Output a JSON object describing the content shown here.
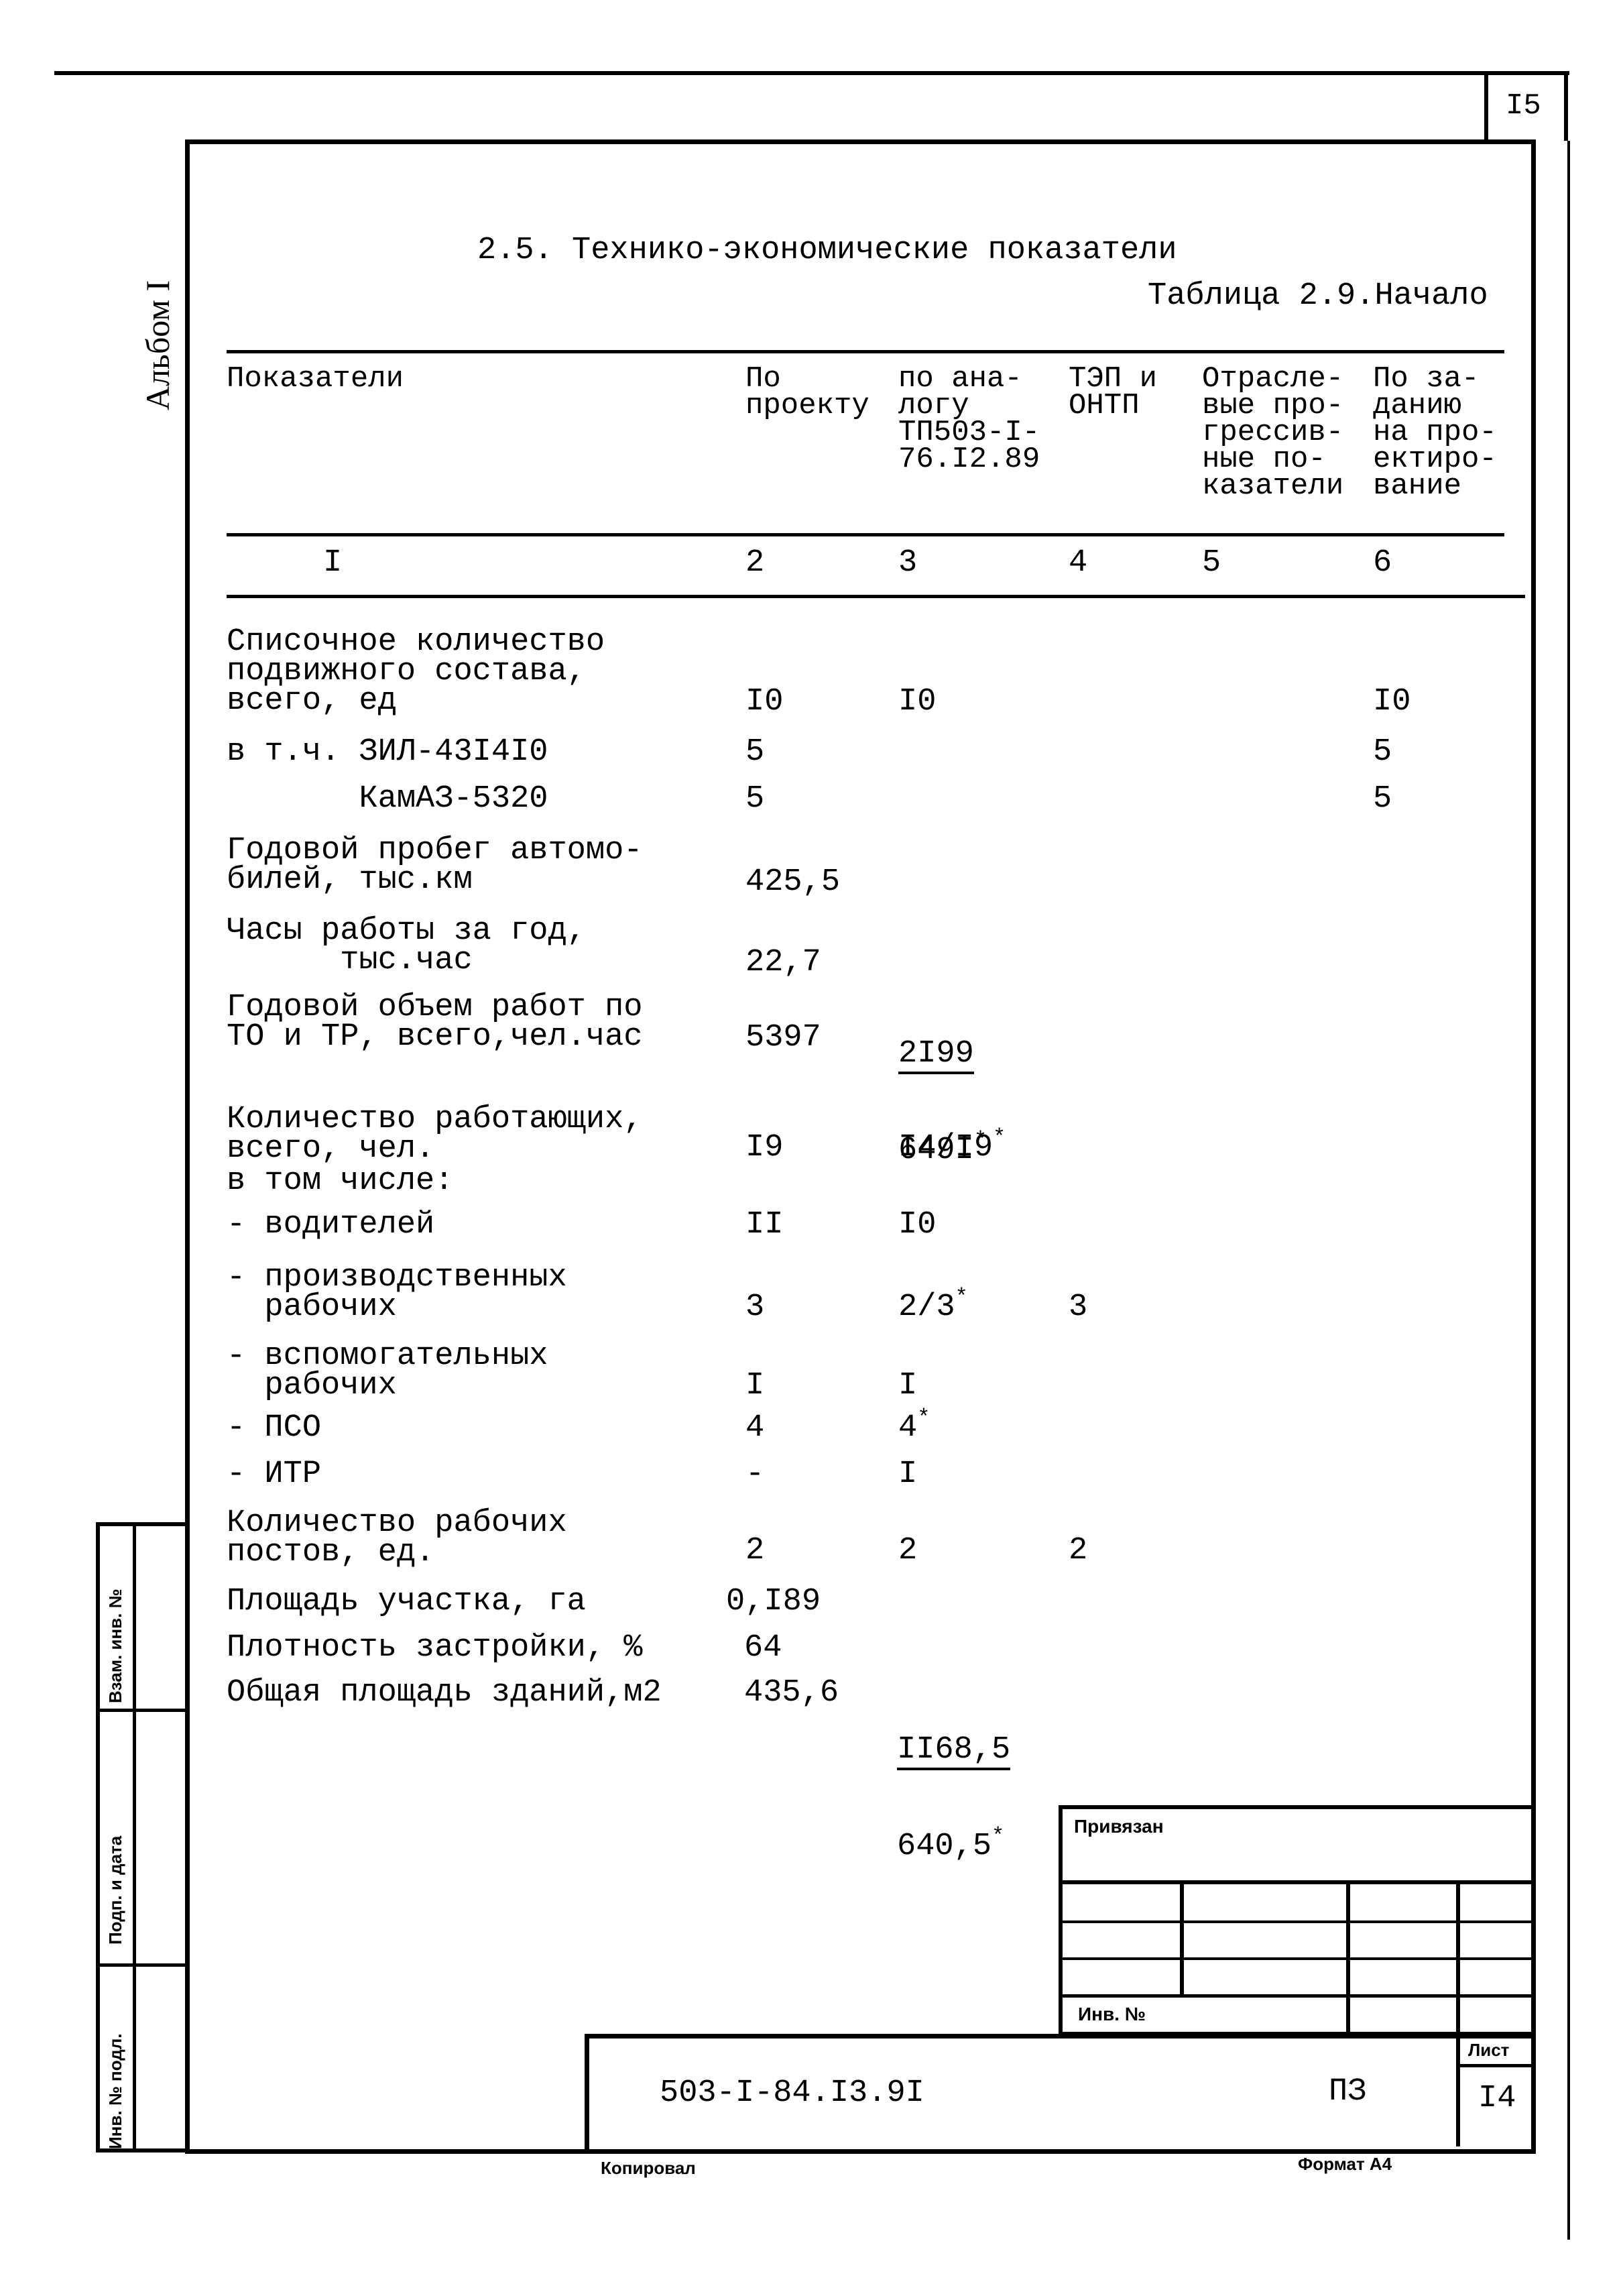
{
  "page_number_top": "I5",
  "album_label": "Альбом I",
  "section_title": "2.5. Технико-экономические показатели",
  "table_caption": "Таблица 2.9.Начало",
  "table": {
    "headers": [
      "Показатели",
      "По\nпроекту",
      "по ана-\nлогу\nТП503-I-\n76.I2.89",
      "ТЭП и\nОНТП",
      "Отрасле-\nвые про-\nгрессив-\nные по-\nказатели",
      "По за-\nданию\nна про-\nектиро-\nвание"
    ],
    "column_numbers": [
      "I",
      "2",
      "3",
      "4",
      "5",
      "6"
    ],
    "rows": [
      {
        "label": "Списочное количество\nподвижного состава,\nвсего, ед",
        "c2": "I0",
        "c3": "I0",
        "c4": "",
        "c5": "",
        "c6": "I0"
      },
      {
        "label": "в т.ч. ЗИЛ-43I4I0",
        "c2": "5",
        "c3": "",
        "c4": "",
        "c5": "",
        "c6": "5"
      },
      {
        "label": "       КамАЗ-5320",
        "c2": "5",
        "c3": "",
        "c4": "",
        "c5": "",
        "c6": "5"
      },
      {
        "label": "Годовой пробег автомо-\nбилей, тыс.км",
        "c2": "425,5",
        "c3": "",
        "c4": "",
        "c5": "",
        "c6": ""
      },
      {
        "label": "Часы работы за год,\n      тыс.час",
        "c2": "22,7",
        "c3": "",
        "c4": "",
        "c5": "",
        "c6": ""
      },
      {
        "label": "Годовой объем работ по\nТО и ТР, всего,чел.час",
        "c2": "5397",
        "c3_fraction": {
          "numerator": "2I99",
          "denominator": "649I",
          "denominator_mark": "*"
        },
        "c4": "",
        "c5": "",
        "c6": ""
      },
      {
        "label": "Количество работающих,\nвсего, чел.",
        "c2": "I9",
        "c3": "I4/I9",
        "c3_mark": "*",
        "c4": "",
        "c5": "",
        "c6": ""
      },
      {
        "label": "в том числе:",
        "c2": "",
        "c3": "",
        "c4": "",
        "c5": "",
        "c6": ""
      },
      {
        "label": "- водителей",
        "c2": "II",
        "c3": "I0",
        "c4": "",
        "c5": "",
        "c6": ""
      },
      {
        "label": "- производственных\n  рабочих",
        "c2": "3",
        "c3": "2/3",
        "c3_mark": "*",
        "c4": "3",
        "c5": "",
        "c6": ""
      },
      {
        "label": "- вспомогательных\n  рабочих",
        "c2": "I",
        "c3": "I",
        "c4": "",
        "c5": "",
        "c6": ""
      },
      {
        "label": "- ПСО",
        "c2": "4",
        "c3": "4",
        "c3_mark": "*",
        "c4": "",
        "c5": "",
        "c6": ""
      },
      {
        "label": "- ИТР",
        "c2": "-",
        "c3": "I",
        "c4": "",
        "c5": "",
        "c6": ""
      },
      {
        "label": "Количество рабочих\nпостов, ед.",
        "c2": "2",
        "c3": "2",
        "c4": "2",
        "c5": "",
        "c6": ""
      },
      {
        "label": "Площадь участка, га",
        "c2": "0,I89",
        "c3": "",
        "c4": "",
        "c5": "",
        "c6": ""
      },
      {
        "label": "Плотность застройки, %",
        "c2": "64",
        "c3": "",
        "c4": "",
        "c5": "",
        "c6": ""
      },
      {
        "label": "Общая площадь зданий,м2",
        "c2": "435,6",
        "c3_fraction": {
          "numerator": "II68,5",
          "denominator": "640,5",
          "denominator_mark": "*"
        },
        "c4": "",
        "c5": "",
        "c6": ""
      }
    ]
  },
  "side_stamp": {
    "labels": [
      "Взам. инв. №",
      "Подп. и дата",
      "Инв. № подл."
    ]
  },
  "title_block": {
    "bound_label": "Привязан",
    "inv_label": "Инв. №",
    "document_code": "503-I-84.I3.9I",
    "doc_type": "ПЗ",
    "sheet_label": "Лист",
    "sheet_number": "I4"
  },
  "footer": {
    "copied_label": "Копировал",
    "format_label": "Формат А4"
  }
}
